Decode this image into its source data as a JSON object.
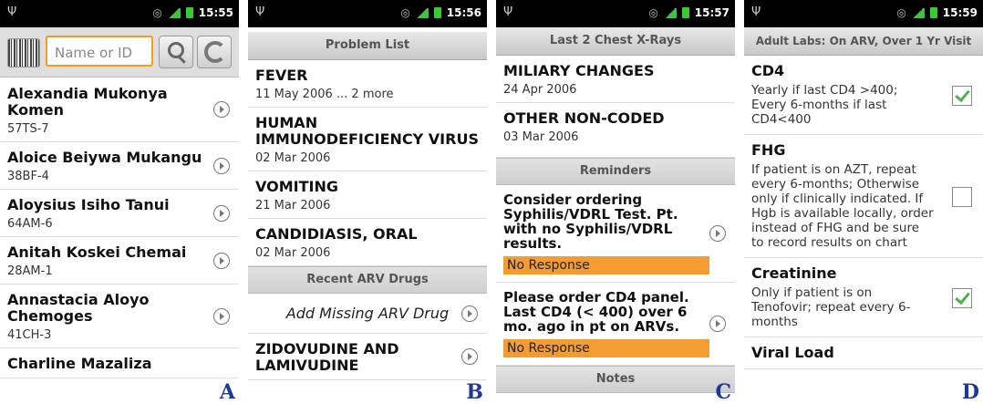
{
  "panel_a": {
    "time": "15:55",
    "search_placeholder": "Name or ID",
    "patients": [
      {
        "name": "Alexandia Mukonya Komen",
        "id": "57TS-7"
      },
      {
        "name": "Aloice Beiywa Mukangu",
        "id": "38BF-4"
      },
      {
        "name": "Aloysius Isiho Tanui",
        "id": "64AM-6"
      },
      {
        "name": "Anitah Koskei Chemai",
        "id": "28AM-1"
      },
      {
        "name": "Annastacia Aloyo Chemoges",
        "id": "41CH-3"
      },
      {
        "name": "Charline Mazaliza",
        "id": ""
      }
    ],
    "letter": "A"
  },
  "panel_b": {
    "time": "15:56",
    "header": "Problem List",
    "problems": [
      {
        "title": "FEVER",
        "date": "11 May 2006 ... 2 more"
      },
      {
        "title": "HUMAN IMMUNODEFICIENCY VIRUS",
        "date": "02 Mar 2006"
      },
      {
        "title": "VOMITING",
        "date": "21 Mar 2006"
      },
      {
        "title": "CANDIDIASIS, ORAL",
        "date": "02 Mar 2006"
      }
    ],
    "arv_header": "Recent ARV Drugs",
    "add_drug": "Add Missing ARV Drug",
    "drug": "ZIDOVUDINE AND LAMIVUDINE",
    "letter": "B"
  },
  "panel_c": {
    "time": "15:57",
    "header": "Last 2 Chest X-Rays",
    "xrays": [
      {
        "title": "MILIARY CHANGES",
        "date": "24 Apr 2006"
      },
      {
        "title": "OTHER NON-CODED",
        "date": "03 Mar 2006"
      }
    ],
    "reminders_header": "Reminders",
    "reminders": [
      {
        "text": "Consider ordering Syphilis/VDRL Test. Pt. with no Syphilis/VDRL results.",
        "response": "No Response"
      },
      {
        "text": "Please order CD4 panel. Last CD4 (< 400) over 6 mo. ago in pt on ARVs.",
        "response": "No Response"
      }
    ],
    "notes_header": "Notes",
    "letter": "C"
  },
  "panel_d": {
    "time": "15:59",
    "header": "Adult Labs: On ARV, Over 1 Yr Visit",
    "labs": [
      {
        "title": "CD4",
        "desc": "Yearly if last CD4 >400; Every 6-months if last CD4<400",
        "checked": true
      },
      {
        "title": "FHG",
        "desc": "If patient is on AZT, repeat every 6-months; Otherwise only if clinically indicated. If Hgb is available locally, order instead of FHG and be sure to record results on chart",
        "checked": false
      },
      {
        "title": "Creatinine",
        "desc": "Only if patient is on Tenofovir; repeat every 6-months",
        "checked": true
      },
      {
        "title": "Viral Load",
        "desc": "",
        "checked": false
      }
    ],
    "letter": "D"
  }
}
